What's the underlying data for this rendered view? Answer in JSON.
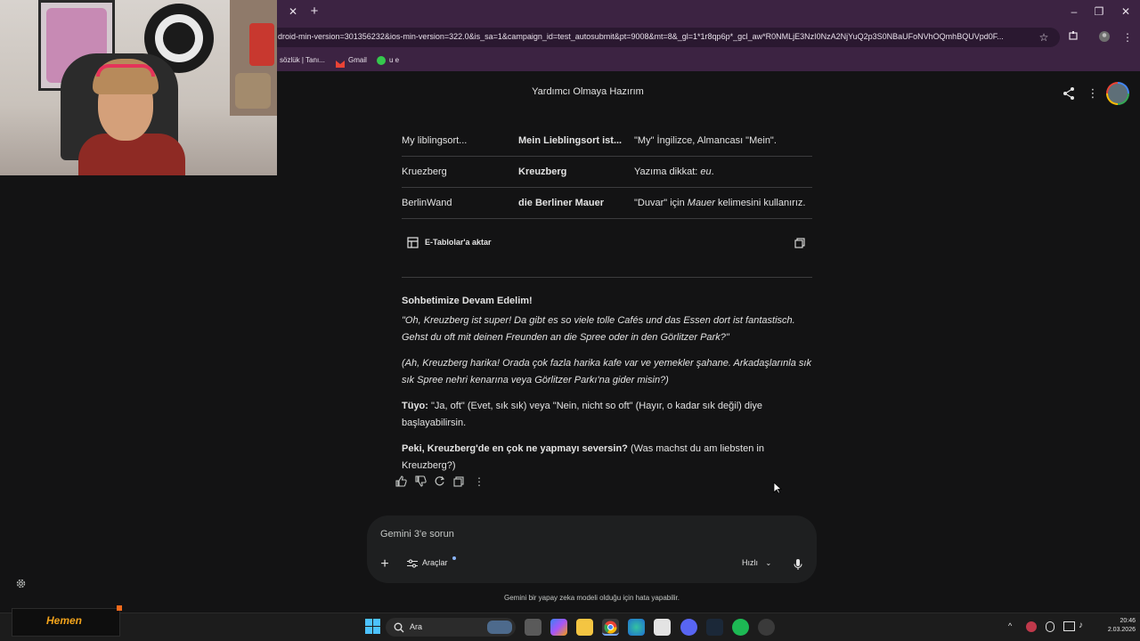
{
  "browser": {
    "url": "droid-min-version=301356232&ios-min-version=322.0&is_sa=1&campaign_id=test_autosubmit&pt=9008&mt=8&_gl=1*1r8qp6p*_gcl_aw*R0NMLjE3NzI0NzA2NjYuQ2p3S0NBaUFoNVhOQmhBQUVpd0F...",
    "bookmarks": [
      {
        "label": "sözlük | Tanı..."
      },
      {
        "label": "Gmail"
      },
      {
        "label": "u e"
      }
    ]
  },
  "gemini": {
    "chat_title": "Yardımcı Olmaya Hazırım",
    "table_rows": [
      {
        "col1": "My liblingsort...",
        "col2": "Mein Lieblingsort ist...",
        "col3_pre": "\"My\" İngilizce, Almancası \"Mein\".",
        "col3_em": "",
        "col3_post": ""
      },
      {
        "col1": "Kruezberg",
        "col2": "Kreuzberg",
        "col3_pre": "Yazıma dikkat: ",
        "col3_em": "eu",
        "col3_post": "."
      },
      {
        "col1": "BerlinWand",
        "col2": "die Berliner Mauer",
        "col3_pre": "\"Duvar\" için ",
        "col3_em": "Mauer",
        "col3_post": " kelimesini kullanırız."
      }
    ],
    "export_label": "E-Tablolar'a aktar",
    "section_heading": "Sohbetimize Devam Edelim!",
    "german_text": "\"Oh, Kreuzberg ist super! Da gibt es so viele tolle Cafés und das Essen dort ist fantastisch. Gehst du oft mit deinen Freunden an die Spree oder in den Görlitzer Park?\"",
    "translation": "(Ah, Kreuzberg harika! Orada çok fazla harika kafe var ve yemekler şahane. Arkadaşlarınla sık sık Spree nehri kenarına veya Görlitzer Parkı'na gider misin?)",
    "tip_label": "Tüyo:",
    "tip_text": " \"Ja, oft\" (Evet, sık sık) veya \"Nein, nicht so oft\" (Hayır, o kadar sık değil) diye başlayabilirsin.",
    "question_bold": "Peki, Kreuzberg'de en çok ne yapmayı seversin?",
    "question_rest": " (Was machst du am liebsten in Kreuzberg?)",
    "input_placeholder": "Gemini 3'e sorun",
    "tools_label": "Araçlar",
    "speed_label": "Hızlı",
    "disclaimer": "Gemini bir yapay zeka modeli olduğu için hata yapabilir."
  },
  "overlay": {
    "ad_text": "Hemen"
  },
  "taskbar": {
    "search_label": "Ara",
    "time": "20:46",
    "date": "2.03.2026"
  },
  "colors": {
    "chrome_bg": "#3c2342",
    "page_bg": "#131314",
    "input_bg": "#1e1f20",
    "taskbar_bg": "#1c1c1c"
  }
}
